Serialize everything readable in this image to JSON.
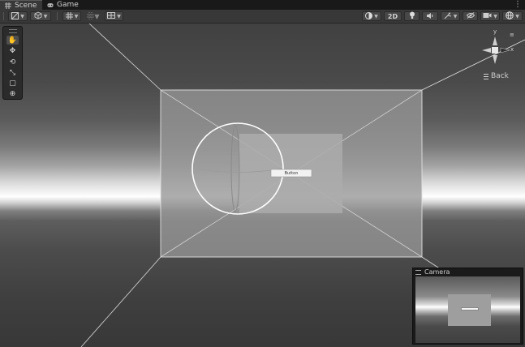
{
  "tabs": [
    {
      "label": "Scene",
      "icon": "scene-grid-icon",
      "active": true
    },
    {
      "label": "Game",
      "icon": "gamepad-icon",
      "active": false
    }
  ],
  "menu_icon": "kebab-icon",
  "toolbar": {
    "left": [
      {
        "name": "draw-mode-button",
        "icon": "shaded-icon"
      },
      {
        "name": "render-mode-button",
        "icon": "cube-icon"
      },
      {
        "name": "grid-snap-button",
        "icon": "grid-icon"
      },
      {
        "name": "increment-snap-button",
        "icon": "snap-grid-icon"
      },
      {
        "name": "view-options-button",
        "icon": "grid-overlay-icon"
      }
    ],
    "right": {
      "shading_icon": "shading-sphere-icon",
      "mode_2d_label": "2D",
      "lighting_icon": "lightbulb-icon",
      "audio_icon": "speaker-icon",
      "effects_icon": "effects-icon",
      "visibility_icon": "eye-slash-icon",
      "camera_icon": "video-camera-icon",
      "gizmos_icon": "globe-icon"
    }
  },
  "tools": [
    {
      "name": "hand-tool",
      "icon": "hand-icon",
      "glyph": "✋",
      "selected": true
    },
    {
      "name": "move-tool",
      "icon": "move-icon",
      "glyph": "✥",
      "selected": false
    },
    {
      "name": "rotate-tool",
      "icon": "rotate-icon",
      "glyph": "⟲",
      "selected": false
    },
    {
      "name": "scale-tool",
      "icon": "scale-icon",
      "glyph": "⤡",
      "selected": false
    },
    {
      "name": "rect-tool",
      "icon": "rect-icon",
      "glyph": "▢",
      "selected": false
    },
    {
      "name": "transform-tool",
      "icon": "transform-icon",
      "glyph": "⊕",
      "selected": false
    }
  ],
  "gizmo": {
    "y_label": "y",
    "x_label": "x",
    "z_label": "≡"
  },
  "back_label": "Back",
  "scene": {
    "button_label": "Button"
  },
  "camera_preview": {
    "title": "Camera"
  },
  "colors": {
    "panel_bg": "#383838",
    "tab_bar_bg": "#191919",
    "button_bg": "#474747"
  }
}
